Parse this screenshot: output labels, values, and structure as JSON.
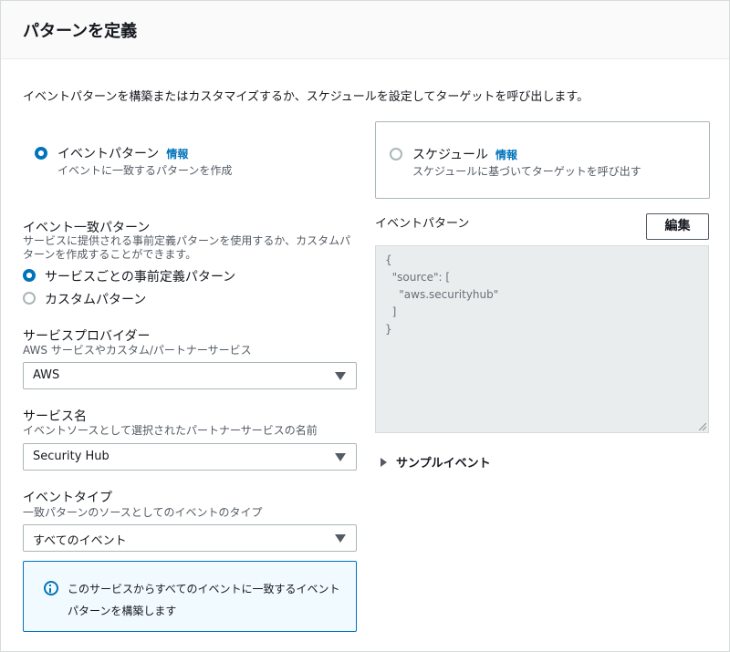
{
  "header": {
    "title": "パターンを定義"
  },
  "intro": "イベントパターンを構築またはカスタマイズするか、スケジュールを設定してターゲットを呼び出します。",
  "pattern_type": {
    "event": {
      "label": "イベントパターン",
      "info": "情報",
      "desc": "イベントに一致するパターンを作成",
      "selected": true
    },
    "schedule": {
      "label": "スケジュール",
      "info": "情報",
      "desc": "スケジュールに基づいてターゲットを呼び出す",
      "selected": false
    }
  },
  "match_pattern": {
    "label": "イベント一致パターン",
    "desc": "サービスに提供される事前定義パターンを使用するか、カスタムパターンを作成することができます。",
    "options": [
      {
        "label": "サービスごとの事前定義パターン",
        "selected": true
      },
      {
        "label": "カスタムパターン",
        "selected": false
      }
    ]
  },
  "service_provider": {
    "label": "サービスプロバイダー",
    "desc": "AWS サービスやカスタム/パートナーサービス",
    "value": "AWS"
  },
  "service_name": {
    "label": "サービス名",
    "desc": "イベントソースとして選択されたパートナーサービスの名前",
    "value": "Security Hub"
  },
  "event_type": {
    "label": "イベントタイプ",
    "desc": "一致パターンのソースとしてのイベントのタイプ",
    "value": "すべてのイベント"
  },
  "alert": {
    "text": "このサービスからすべてのイベントに一致するイベントパターンを構築します"
  },
  "event_pattern": {
    "label": "イベントパターン",
    "edit_label": "編集",
    "code_lines": [
      "{",
      "  \"source\": [",
      "    \"aws.securityhub\"",
      "  ]",
      "}"
    ]
  },
  "sample_event": {
    "label": "サンプルイベント"
  },
  "colors": {
    "accent": "#0073bb",
    "code_bg": "#eaeded",
    "alert_bg": "#f1faff"
  }
}
